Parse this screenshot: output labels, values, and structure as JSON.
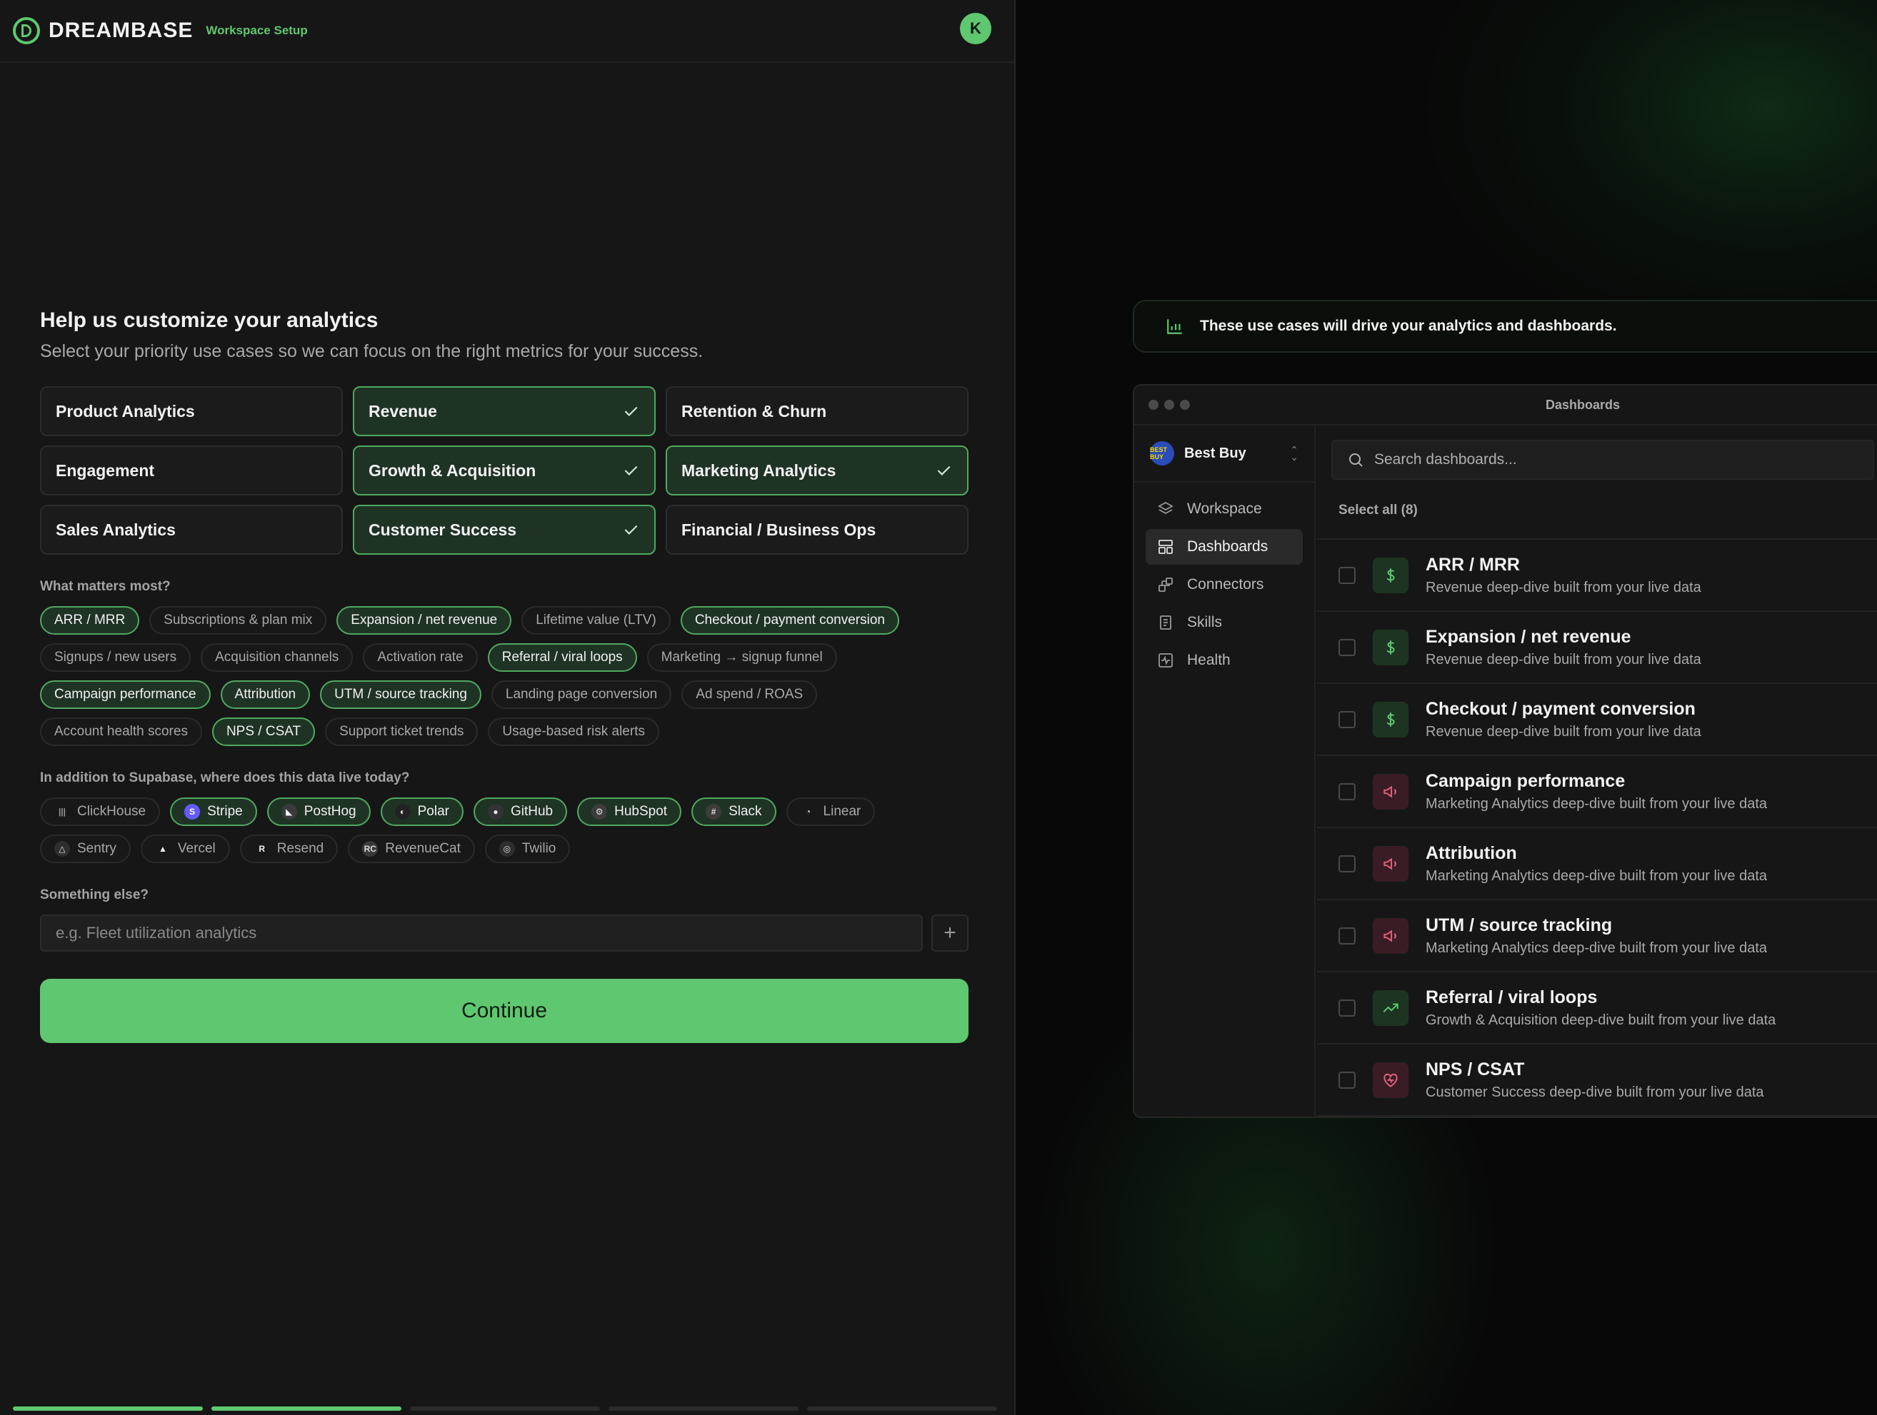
{
  "brand": {
    "name": "DREAMBASE",
    "subtitle": "Workspace Setup",
    "avatar_initial": "K",
    "accent": "#5fc76f"
  },
  "intro": {
    "title": "Help us customize your analytics",
    "subtitle": "Select your priority use cases so we can focus on the right metrics for your success."
  },
  "use_cases": [
    {
      "label": "Product Analytics",
      "selected": false
    },
    {
      "label": "Revenue",
      "selected": true
    },
    {
      "label": "Retention & Churn",
      "selected": false
    },
    {
      "label": "Engagement",
      "selected": false
    },
    {
      "label": "Growth & Acquisition",
      "selected": true
    },
    {
      "label": "Marketing Analytics",
      "selected": true
    },
    {
      "label": "Sales Analytics",
      "selected": false
    },
    {
      "label": "Customer Success",
      "selected": true
    },
    {
      "label": "Financial / Business Ops",
      "selected": false
    }
  ],
  "metrics": {
    "label": "What matters most?",
    "items": [
      {
        "label": "ARR / MRR",
        "selected": true
      },
      {
        "label": "Subscriptions & plan mix",
        "selected": false
      },
      {
        "label": "Expansion / net revenue",
        "selected": true
      },
      {
        "label": "Lifetime value (LTV)",
        "selected": false
      },
      {
        "label": "Checkout / payment conversion",
        "selected": true
      },
      {
        "label": "Signups / new users",
        "selected": false
      },
      {
        "label": "Acquisition channels",
        "selected": false
      },
      {
        "label": "Activation rate",
        "selected": false
      },
      {
        "label": "Referral / viral loops",
        "selected": true
      },
      {
        "label": "Marketing → signup funnel",
        "selected": false
      },
      {
        "label": "Campaign performance",
        "selected": true
      },
      {
        "label": "Attribution",
        "selected": true
      },
      {
        "label": "UTM / source tracking",
        "selected": true
      },
      {
        "label": "Landing page conversion",
        "selected": false
      },
      {
        "label": "Ad spend / ROAS",
        "selected": false
      },
      {
        "label": "Account health scores",
        "selected": false
      },
      {
        "label": "NPS / CSAT",
        "selected": true
      },
      {
        "label": "Support ticket trends",
        "selected": false
      },
      {
        "label": "Usage-based risk alerts",
        "selected": false
      }
    ]
  },
  "sources": {
    "label": "In addition to Supabase, where does this data live today?",
    "items": [
      {
        "label": "ClickHouse",
        "icon": "clickhouse-icon",
        "selected": false,
        "glyph": "|||",
        "color": "#9a9a9a",
        "bg": "transparent"
      },
      {
        "label": "Stripe",
        "icon": "stripe-icon",
        "selected": true,
        "glyph": "S",
        "color": "#ffffff",
        "bg": "#635bff"
      },
      {
        "label": "PostHog",
        "icon": "posthog-icon",
        "selected": true,
        "glyph": "◣",
        "color": "#f5f5f5",
        "bg": "#3a3a3a"
      },
      {
        "label": "Polar",
        "icon": "polar-icon",
        "selected": true,
        "glyph": "◐",
        "color": "#f5f5f5",
        "bg": "#222222"
      },
      {
        "label": "GitHub",
        "icon": "github-icon",
        "selected": true,
        "glyph": "●",
        "color": "#e8e8e8",
        "bg": "#333333"
      },
      {
        "label": "HubSpot",
        "icon": "hubspot-icon",
        "selected": true,
        "glyph": "⚙",
        "color": "#e0e0e0",
        "bg": "#3d3d3d"
      },
      {
        "label": "Slack",
        "icon": "slack-icon",
        "selected": true,
        "glyph": "#",
        "color": "#e0e0e0",
        "bg": "#3d3d3d"
      },
      {
        "label": "Linear",
        "icon": "linear-icon",
        "selected": false,
        "glyph": "◔",
        "color": "#e0e0e0",
        "bg": "transparent"
      },
      {
        "label": "Sentry",
        "icon": "sentry-icon",
        "selected": false,
        "glyph": "△",
        "color": "#e0e0e0",
        "bg": "#2e2e2e"
      },
      {
        "label": "Vercel",
        "icon": "vercel-icon",
        "selected": false,
        "glyph": "▲",
        "color": "#f0f0f0",
        "bg": "transparent"
      },
      {
        "label": "Resend",
        "icon": "resend-icon",
        "selected": false,
        "glyph": "R",
        "color": "#f0f0f0",
        "bg": "transparent"
      },
      {
        "label": "RevenueCat",
        "icon": "revenuecat-icon",
        "selected": false,
        "glyph": "RC",
        "color": "#dcdcdc",
        "bg": "#3a3a3a"
      },
      {
        "label": "Twilio",
        "icon": "twilio-icon",
        "selected": false,
        "glyph": "◎",
        "color": "#dcdcdc",
        "bg": "#2e2e2e"
      }
    ]
  },
  "other": {
    "label": "Something else?",
    "placeholder": "e.g. Fleet utilization analytics",
    "value": ""
  },
  "continue_label": "Continue",
  "progress": {
    "steps_total": 5,
    "steps_done": 2
  },
  "preview": {
    "banner": "These use cases will drive your analytics and dashboards.",
    "window_title": "Dashboards",
    "workspace": {
      "name": "Best Buy",
      "logo_text": "BEST BUY"
    },
    "nav": [
      {
        "label": "Workspace",
        "icon": "layers-icon",
        "active": false
      },
      {
        "label": "Dashboards",
        "icon": "dashboard-icon",
        "active": true
      },
      {
        "label": "Connectors",
        "icon": "connectors-icon",
        "active": false
      },
      {
        "label": "Skills",
        "icon": "skills-icon",
        "active": false
      },
      {
        "label": "Health",
        "icon": "health-icon",
        "active": false
      }
    ],
    "search_placeholder": "Search dashboards...",
    "select_all": "Select all (8)",
    "dashboards": [
      {
        "title": "ARR / MRR",
        "desc": "Revenue deep-dive built from your live data",
        "icon": "dollar-icon",
        "tone": "green"
      },
      {
        "title": "Expansion / net revenue",
        "desc": "Revenue deep-dive built from your live data",
        "icon": "dollar-icon",
        "tone": "green"
      },
      {
        "title": "Checkout / payment conversion",
        "desc": "Revenue deep-dive built from your live data",
        "icon": "dollar-icon",
        "tone": "green"
      },
      {
        "title": "Campaign performance",
        "desc": "Marketing Analytics deep-dive built from your live data",
        "icon": "megaphone-icon",
        "tone": "red"
      },
      {
        "title": "Attribution",
        "desc": "Marketing Analytics deep-dive built from your live data",
        "icon": "megaphone-icon",
        "tone": "red"
      },
      {
        "title": "UTM / source tracking",
        "desc": "Marketing Analytics deep-dive built from your live data",
        "icon": "megaphone-icon",
        "tone": "red"
      },
      {
        "title": "Referral / viral loops",
        "desc": "Growth & Acquisition deep-dive built from your live data",
        "icon": "trend-up-icon",
        "tone": "green"
      },
      {
        "title": "NPS / CSAT",
        "desc": "Customer Success deep-dive built from your live data",
        "icon": "heart-icon",
        "tone": "red"
      }
    ]
  }
}
